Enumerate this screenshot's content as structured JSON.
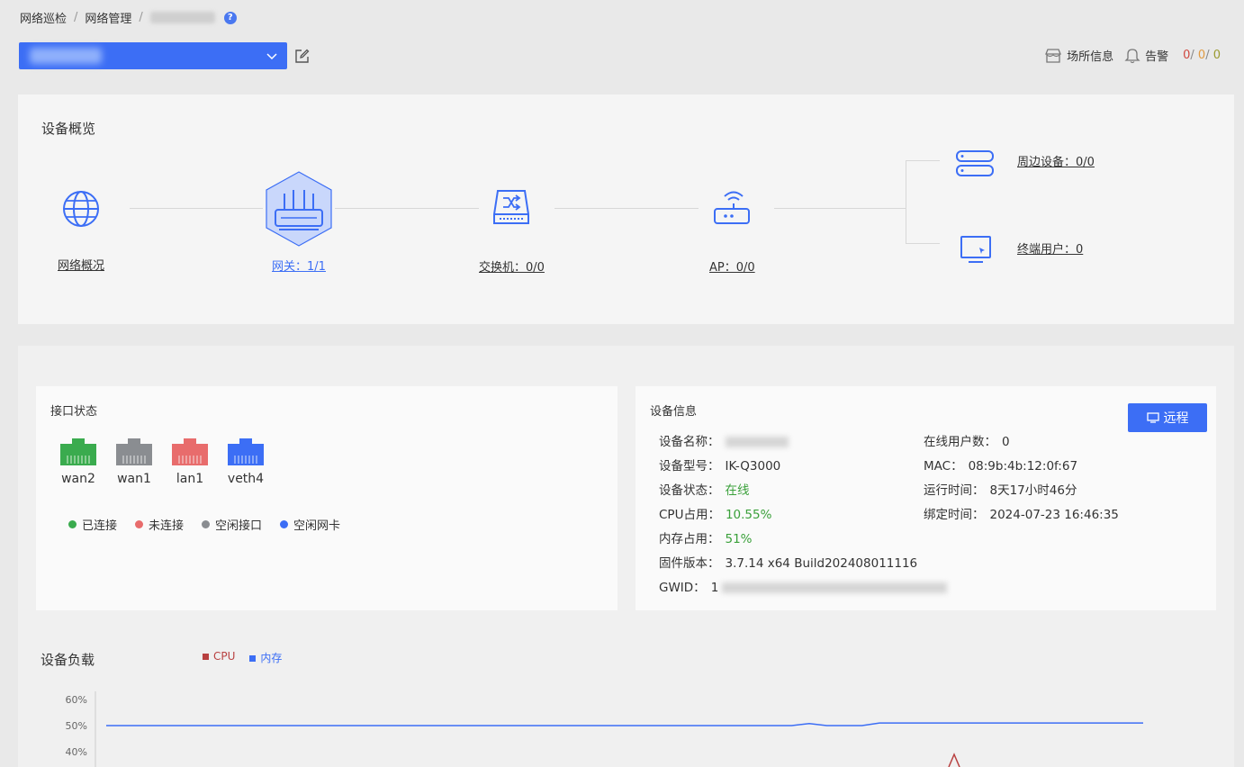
{
  "breadcrumb": {
    "items": [
      "网络巡检",
      "网络管理"
    ],
    "separator": "/"
  },
  "topbar": {
    "site_info": "场所信息",
    "alarm": "告警",
    "counts": [
      "0",
      "0",
      "0"
    ],
    "count_sep": "/"
  },
  "overview": {
    "title": "设备概览",
    "nodes": {
      "network": "网络概况",
      "gateway": "网关：1/1",
      "switch": "交换机：0/0",
      "ap": "AP：0/0",
      "peripheral": "周边设备：0/0",
      "terminal": "终端用户：0"
    }
  },
  "interface": {
    "title": "接口状态",
    "ports": [
      {
        "name": "wan2",
        "status": "connected"
      },
      {
        "name": "wan1",
        "status": "idle"
      },
      {
        "name": "lan1",
        "status": "disconnected"
      },
      {
        "name": "veth4",
        "status": "vnic"
      }
    ],
    "legend": {
      "connected": "已连接",
      "disconnected": "未连接",
      "idle": "空闲接口",
      "vnic": "空闲网卡"
    },
    "colors": {
      "connected": "#3aab4e",
      "idle": "#8a8d91",
      "disconnected": "#e86c6c",
      "vnic": "#3c6ef5"
    }
  },
  "device_info": {
    "title": "设备信息",
    "remote_button": "远程",
    "left": [
      {
        "key": "设备名称：",
        "value": ""
      },
      {
        "key": "设备型号：",
        "value": "IK-Q3000"
      },
      {
        "key": "设备状态：",
        "value": "在线"
      },
      {
        "key": "CPU占用：",
        "value": "10.55%"
      },
      {
        "key": "内存占用：",
        "value": "51%"
      },
      {
        "key": "固件版本：",
        "value": "3.7.14 x64 Build202408011116"
      },
      {
        "key": "GWID：",
        "value": "1"
      }
    ],
    "right": [
      {
        "key": "在线用户数：",
        "value": "0"
      },
      {
        "key": "MAC：",
        "value": "08:9b:4b:12:0f:67"
      },
      {
        "key": "运行时间：",
        "value": "8天17小时46分"
      },
      {
        "key": "绑定时间：",
        "value": "2024-07-23 16:46:35"
      }
    ]
  },
  "load": {
    "title": "设备负载",
    "legend": {
      "cpu": "CPU",
      "mem": "内存"
    },
    "colors": {
      "cpu": "#b84040",
      "mem": "#3c6ef5"
    }
  },
  "chart_data": {
    "type": "line",
    "title": "设备负载",
    "yticks": [
      "60%",
      "50%",
      "40%"
    ],
    "ylim": [
      0,
      60
    ],
    "series": [
      {
        "name": "内存",
        "values": [
          50,
          50,
          50,
          50,
          50,
          50,
          50,
          50,
          50,
          50,
          50,
          50,
          50,
          50,
          50,
          50,
          50,
          50,
          50,
          50,
          50,
          50,
          50,
          50,
          50,
          50,
          50,
          50,
          50,
          50,
          50,
          50,
          50,
          50,
          50,
          50,
          50,
          50,
          50,
          50,
          50.8,
          50,
          50,
          50,
          51,
          51,
          51,
          51,
          51,
          51,
          51,
          51,
          51,
          51,
          51,
          51,
          51,
          51,
          51,
          51
        ]
      },
      {
        "name": "CPU",
        "values": []
      }
    ]
  }
}
